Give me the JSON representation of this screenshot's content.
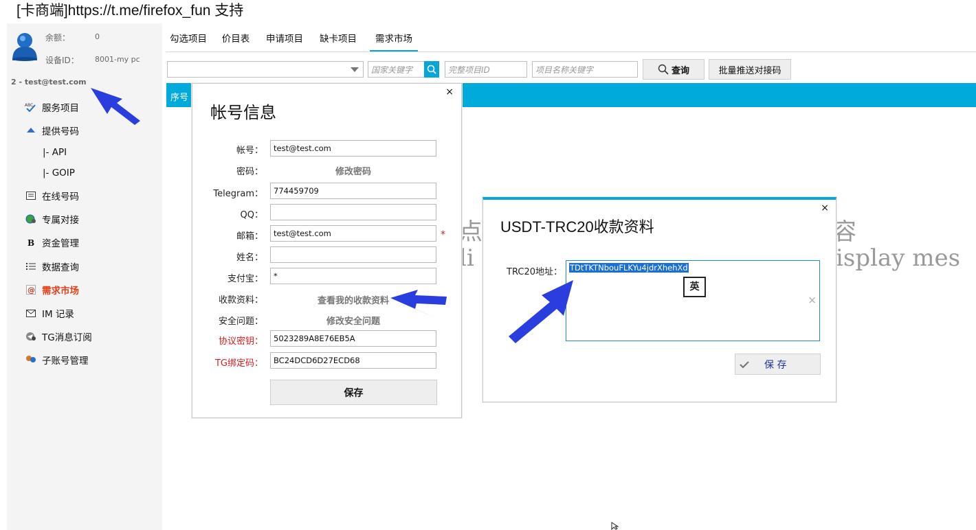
{
  "app": {
    "title": "[卡商端]https://t.me/firefox_fun 支持"
  },
  "sidebar": {
    "balance_label": "余额：",
    "balance_value": "0",
    "device_label": "设备ID：",
    "device_value": "8001-my pc",
    "user_line": "2 - test@test.com",
    "items": [
      {
        "label": "服务项目",
        "icon": "abc-check-icon"
      },
      {
        "label": "提供号码",
        "icon": "upload-arrow-icon"
      },
      {
        "label": "|-  API",
        "icon": ""
      },
      {
        "label": "|-  GOIP",
        "icon": ""
      },
      {
        "label": "在线号码",
        "icon": "list-window-icon"
      },
      {
        "label": "专属对接",
        "icon": "globe-user-icon"
      },
      {
        "label": "资金管理",
        "icon": "bold-b-icon"
      },
      {
        "label": "数据查询",
        "icon": "list-icon"
      },
      {
        "label": "需求市场",
        "icon": "at-icon"
      },
      {
        "label": "IM 记录",
        "icon": "envelope-icon"
      },
      {
        "label": "TG消息订阅",
        "icon": "telegram-icon"
      },
      {
        "label": "子账号管理",
        "icon": "users-icon"
      }
    ],
    "active_item": "需求市场"
  },
  "tabs": [
    "勾选项目",
    "价目表",
    "申请项目",
    "缺卡项目",
    "需求市场"
  ],
  "active_tab": "需求市场",
  "toolbar": {
    "select_value": "",
    "country_placeholder": "国家关键字",
    "project_id_placeholder": "完整项目ID",
    "project_name_placeholder": "项目名称关键字",
    "query_label": "查询",
    "push_label": "批量推送对接码"
  },
  "table": {
    "first_header": "序号"
  },
  "background_message": {
    "line1_left": "点击",
    "line1_right": "容",
    "line2_left": "li",
    "line2_right": "isplay mes"
  },
  "account_dialog": {
    "title": "帐号信息",
    "close": "×",
    "fields": {
      "account_label": "帐号：",
      "account_value": "test@test.com",
      "password_label": "密码：",
      "password_link": "修改密码",
      "telegram_label": "Telegram：",
      "telegram_value": "774459709",
      "qq_label": "QQ：",
      "qq_value": "",
      "email_label": "邮箱：",
      "email_value": "test@test.com",
      "email_required": "*",
      "name_label": "姓名：",
      "name_value": "",
      "alipay_label": "支付宝：",
      "alipay_value": "*",
      "payment_label": "收款资料：",
      "payment_link": "查看我的收款资料",
      "security_label": "安全问题：",
      "security_link": "修改安全问题",
      "protocol_key_label": "协议密钥：",
      "protocol_key_value": "5023289A8E76EB5A",
      "tg_bind_label": "TG绑定码：",
      "tg_bind_value": "BC24DCD6D27ECD68"
    },
    "save_label": "保存"
  },
  "usdt_dialog": {
    "title": "USDT-TRC20收款资料",
    "close": "×",
    "address_label": "TRC20地址：",
    "address_value": "TDtTKTNbouFLKYu4jdrXhehXd",
    "ime_indicator": "英",
    "clear": "×",
    "save_label": "保 存"
  },
  "colors": {
    "accent": "#06a6d9",
    "table_header": "#00abdb",
    "active_nav": "#e0421a",
    "arrow": "#2a3ee0",
    "required": "#d41d1d"
  }
}
